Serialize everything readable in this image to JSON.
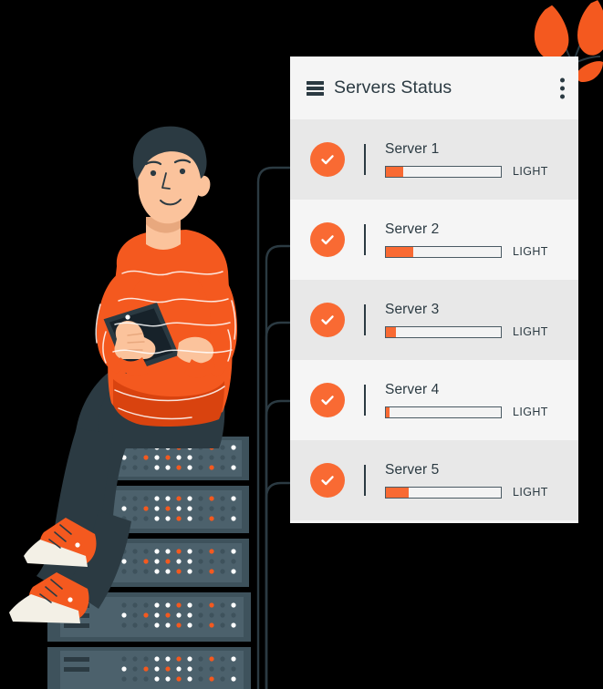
{
  "panel": {
    "title": "Servers Status",
    "menu_icon": "hamburger-icon",
    "more_icon": "more-vertical-icon",
    "accent_color": "#f96a33",
    "text_color": "#2b3a42",
    "header_bg": "#f5f5f5",
    "row_bg_odd": "#e8e8e8",
    "row_bg_even": "#f5f5f5"
  },
  "servers": [
    {
      "name": "Server 1",
      "status_icon": "check-circle-icon",
      "load_label": "LIGHT",
      "load_percent": 15
    },
    {
      "name": "Server 2",
      "status_icon": "check-circle-icon",
      "load_label": "LIGHT",
      "load_percent": 24
    },
    {
      "name": "Server 3",
      "status_icon": "check-circle-icon",
      "load_label": "LIGHT",
      "load_percent": 9
    },
    {
      "name": "Server 4",
      "status_icon": "check-circle-icon",
      "load_label": "LIGHT",
      "load_percent": 3
    },
    {
      "name": "Server 5",
      "status_icon": "check-circle-icon",
      "load_label": "LIGHT",
      "load_percent": 20
    }
  ],
  "illustration": {
    "person_icon": "person-with-tablet-illustration",
    "racks_icon": "server-rack-illustration",
    "plant_icon": "orange-leaves-illustration",
    "connectors_icon": "connector-lines",
    "colors": {
      "sweater": "#f4591f",
      "sweater_shadow": "#d9430f",
      "skin": "#fbc39c",
      "hair": "#2b3a42",
      "pants": "#2b3a42",
      "rack_body": "#4c616c",
      "rack_dark": "#2b3a42",
      "led_white": "#ffffff",
      "led_orange": "#f4591f",
      "led_off": "#3e525c",
      "shoe": "#f4591f",
      "sole": "#f3f0e6"
    }
  }
}
